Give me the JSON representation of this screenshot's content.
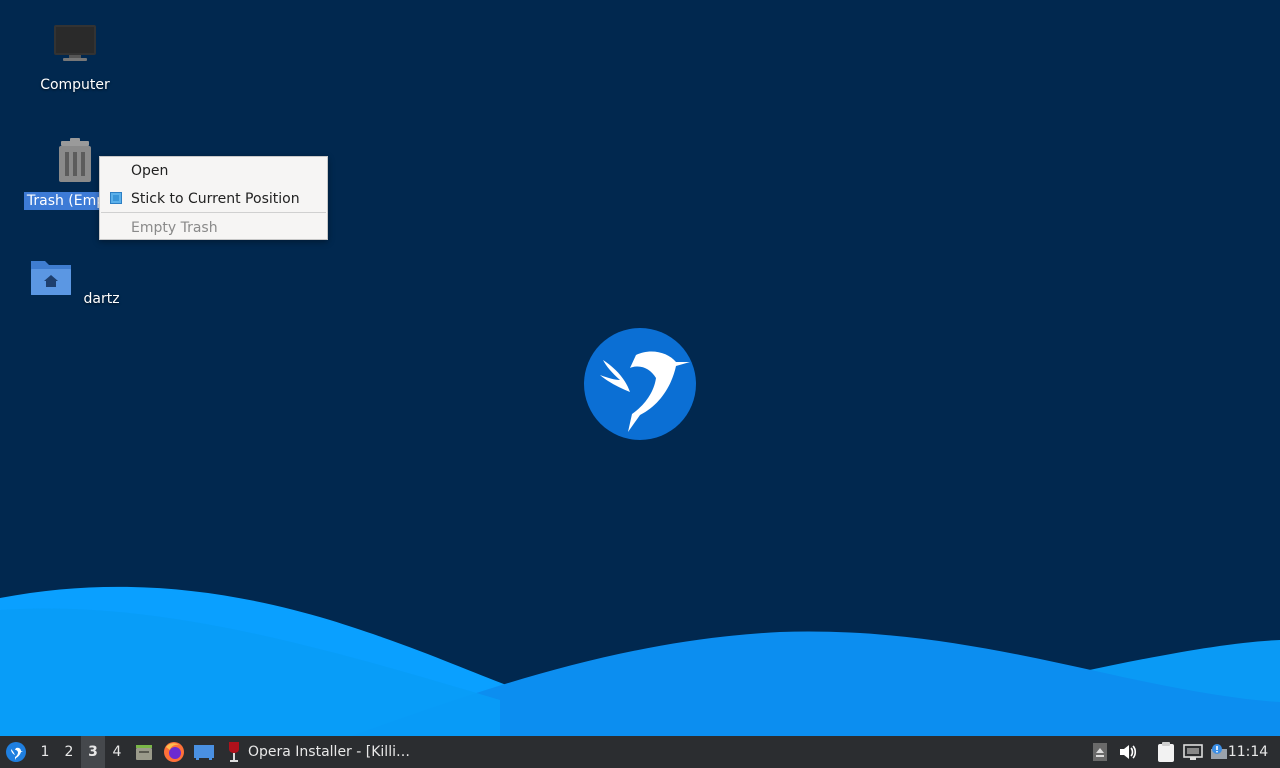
{
  "desktop": {
    "icons": [
      {
        "id": "computer",
        "label": "Computer",
        "icon": "monitor-icon"
      },
      {
        "id": "trash",
        "label": "Trash (Emp",
        "icon": "trash-icon",
        "selected": true
      },
      {
        "id": "home",
        "label": "dartz",
        "icon": "home-folder-icon"
      }
    ],
    "wallpaper_logo": "hummingbird-logo"
  },
  "context_menu": {
    "items": [
      {
        "label": "Open",
        "enabled": true
      },
      {
        "label": "Stick to Current Position",
        "enabled": true,
        "checked": true
      },
      {
        "label": "Empty Trash",
        "enabled": false
      }
    ]
  },
  "taskbar": {
    "start_icon": "hummingbird-menu-icon",
    "workspaces": [
      "1",
      "2",
      "3",
      "4"
    ],
    "active_workspace": "3",
    "launchers": [
      "file-manager-icon",
      "firefox-icon",
      "show-desktop-icon"
    ],
    "tasks": [
      {
        "label": "Opera Installer - [Killi…",
        "icon": "wine-icon"
      }
    ],
    "tray": [
      "tray-expander-icon",
      "volume-icon",
      "clipboard-icon",
      "network-icon",
      "updates-icon"
    ],
    "clock": "11:14"
  },
  "colors": {
    "background": "#01284f",
    "wave_light": "#0aa0ff",
    "wave_dark": "#0873d8",
    "taskbar": "#2b2d30",
    "selection": "#3d7bd6"
  }
}
